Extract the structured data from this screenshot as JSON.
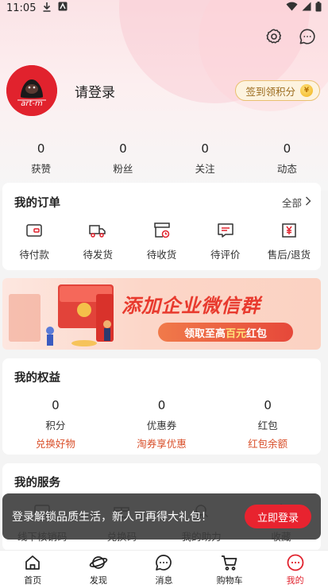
{
  "status_bar": {
    "time": "11:05"
  },
  "profile": {
    "login_text": "请登录",
    "checkin_label": "签到领积分",
    "avatar_text": "art-m"
  },
  "stats": [
    {
      "value": "0",
      "label": "获赞"
    },
    {
      "value": "0",
      "label": "粉丝"
    },
    {
      "value": "0",
      "label": "关注"
    },
    {
      "value": "0",
      "label": "动态"
    }
  ],
  "orders": {
    "title": "我的订单",
    "all_label": "全部",
    "items": [
      {
        "label": "待付款",
        "icon": "wallet-card-icon"
      },
      {
        "label": "待发货",
        "icon": "truck-icon"
      },
      {
        "label": "待收货",
        "icon": "box-clock-icon"
      },
      {
        "label": "待评价",
        "icon": "comment-icon"
      },
      {
        "label": "售后/退货",
        "icon": "yen-receipt-icon"
      }
    ]
  },
  "banner": {
    "title": "添加企业微信群",
    "pill_pre": "领取至高",
    "pill_highlight": "百元",
    "pill_post": "红包"
  },
  "rights": {
    "title": "我的权益",
    "items": [
      {
        "value": "0",
        "label": "积分",
        "sub": "兑换好物"
      },
      {
        "value": "0",
        "label": "优惠券",
        "sub": "淘券享优惠"
      },
      {
        "value": "0",
        "label": "红包",
        "sub": "红包余额"
      }
    ]
  },
  "services": {
    "title": "我的服务",
    "items": [
      {
        "label": "线下核销码"
      },
      {
        "label": "兑换码"
      },
      {
        "label": "我的助力"
      },
      {
        "label": "收藏"
      }
    ]
  },
  "toast": {
    "message": "登录解锁品质生活，新人可再得大礼包！",
    "button": "立即登录"
  },
  "tabbar": {
    "items": [
      {
        "label": "首页",
        "icon": "home-icon"
      },
      {
        "label": "发现",
        "icon": "planet-icon"
      },
      {
        "label": "消息",
        "icon": "message-icon"
      },
      {
        "label": "购物车",
        "icon": "cart-icon"
      },
      {
        "label": "我的",
        "icon": "profile-icon"
      }
    ],
    "active_color": "#e1222d"
  },
  "colors": {
    "brand_red": "#e1222d",
    "accent_orange": "#d9502b",
    "gold": "#e9c070"
  }
}
